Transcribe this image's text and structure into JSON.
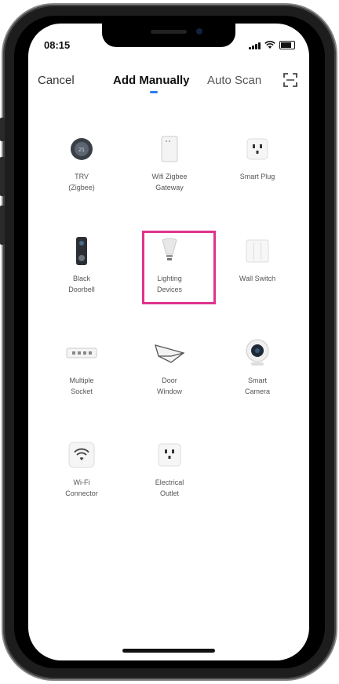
{
  "status": {
    "time": "08:15"
  },
  "nav": {
    "cancel": "Cancel",
    "add_manually": "Add Manually",
    "auto_scan": "Auto Scan"
  },
  "devices": [
    {
      "label1": "TRV",
      "label2": "(Zigbee)",
      "icon": "thermostat-icon"
    },
    {
      "label1": "Wifi Zigbee",
      "label2": "Gateway",
      "icon": "gateway-icon"
    },
    {
      "label1": "Smart Plug",
      "label2": "",
      "icon": "plug-icon"
    },
    {
      "label1": "Black",
      "label2": "Doorbell",
      "icon": "doorbell-icon"
    },
    {
      "label1": "Lighting",
      "label2": "Devices",
      "icon": "bulb-icon"
    },
    {
      "label1": "Wall Switch",
      "label2": "",
      "icon": "wall-switch-icon"
    },
    {
      "label1": "Multiple",
      "label2": "Socket",
      "icon": "power-strip-icon"
    },
    {
      "label1": "Door",
      "label2": "Window",
      "icon": "door-window-sensor-icon"
    },
    {
      "label1": "Smart",
      "label2": "Camera",
      "icon": "camera-icon"
    },
    {
      "label1": "Wi-Fi",
      "label2": "Connector",
      "icon": "wifi-icon"
    },
    {
      "label1": "Electrical",
      "label2": "Outlet",
      "icon": "outlet-icon"
    }
  ],
  "colors": {
    "highlight": "#e0338f",
    "accent": "#2b7de9"
  }
}
